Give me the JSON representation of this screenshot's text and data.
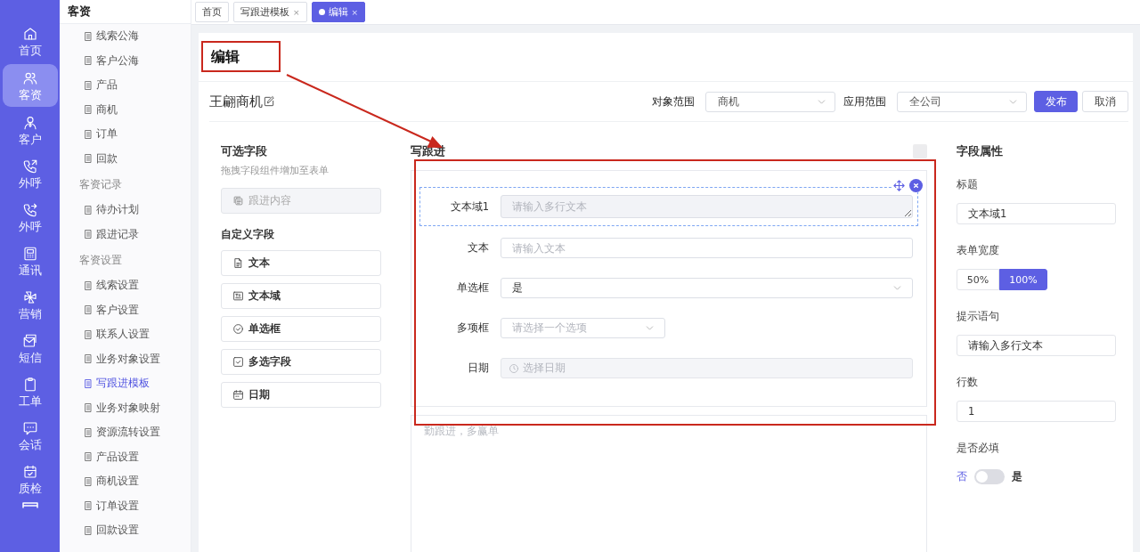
{
  "rail": [
    {
      "label": "首页",
      "selected": false
    },
    {
      "label": "客资",
      "selected": true
    },
    {
      "label": "客户",
      "selected": false
    },
    {
      "label": "外呼",
      "selected": false
    },
    {
      "label": "外呼",
      "selected": false
    },
    {
      "label": "通讯",
      "selected": false
    },
    {
      "label": "营销",
      "selected": false
    },
    {
      "label": "短信",
      "selected": false
    },
    {
      "label": "工单",
      "selected": false
    },
    {
      "label": "会话",
      "selected": false
    },
    {
      "label": "质检",
      "selected": false
    }
  ],
  "menu": {
    "title": "客资",
    "items": [
      {
        "kind": "link",
        "label": "线索公海",
        "selected": false
      },
      {
        "kind": "link",
        "label": "客户公海",
        "selected": false
      },
      {
        "kind": "link",
        "label": "产品",
        "selected": false
      },
      {
        "kind": "link",
        "label": "商机",
        "selected": false
      },
      {
        "kind": "link",
        "label": "订单",
        "selected": false
      },
      {
        "kind": "link",
        "label": "回款",
        "selected": false
      },
      {
        "kind": "group",
        "label": "客资记录"
      },
      {
        "kind": "link",
        "label": "待办计划",
        "selected": false
      },
      {
        "kind": "link",
        "label": "跟进记录",
        "selected": false
      },
      {
        "kind": "group",
        "label": "客资设置"
      },
      {
        "kind": "link",
        "label": "线索设置",
        "selected": false
      },
      {
        "kind": "link",
        "label": "客户设置",
        "selected": false
      },
      {
        "kind": "link",
        "label": "联系人设置",
        "selected": false
      },
      {
        "kind": "link",
        "label": "业务对象设置",
        "selected": false
      },
      {
        "kind": "link",
        "label": "写跟进模板",
        "selected": true
      },
      {
        "kind": "link",
        "label": "业务对象映射",
        "selected": false
      },
      {
        "kind": "link",
        "label": "资源流转设置",
        "selected": false
      },
      {
        "kind": "link",
        "label": "产品设置",
        "selected": false
      },
      {
        "kind": "link",
        "label": "商机设置",
        "selected": false
      },
      {
        "kind": "link",
        "label": "订单设置",
        "selected": false
      },
      {
        "kind": "link",
        "label": "回款设置",
        "selected": false
      }
    ]
  },
  "tabs": [
    {
      "label": "首页",
      "selected": false
    },
    {
      "label": "写跟进模板",
      "close": "×",
      "selected": false
    },
    {
      "label": "编辑",
      "close": "×",
      "selected": true
    }
  ],
  "page": {
    "title": "编辑",
    "name": "王翩商机",
    "filters": [
      {
        "label": "对象范围",
        "value": "商机"
      },
      {
        "label": "应用范围",
        "value": "全公司"
      }
    ],
    "buttons": [
      {
        "label": "发布",
        "kind": "primary"
      },
      {
        "label": "取消",
        "kind": "default"
      }
    ]
  },
  "palette": {
    "title": "可选字段",
    "hint": "拖拽字段组件增加至表单",
    "system": [
      {
        "label": "跟进内容",
        "disabled": true
      }
    ],
    "custom_title": "自定义字段",
    "custom": [
      {
        "label": "文本",
        "disabled": false
      },
      {
        "label": "文本域",
        "disabled": false
      },
      {
        "label": "单选框",
        "disabled": false
      },
      {
        "label": "多选字段",
        "disabled": false
      },
      {
        "label": "日期",
        "disabled": false
      }
    ]
  },
  "form": {
    "title": "写跟进",
    "fields": [
      {
        "kind": "textarea",
        "label": "文本域1",
        "placeholder": "请输入多行文本",
        "selected": true
      },
      {
        "kind": "text",
        "label": "文本",
        "placeholder": "请输入文本",
        "selected": false
      },
      {
        "kind": "select",
        "label": "单选框",
        "value": "是",
        "selected": false
      },
      {
        "kind": "multiselect",
        "label": "多项框",
        "placeholder": "请选择一个选项",
        "selected": false
      },
      {
        "kind": "date",
        "label": "日期",
        "placeholder": "选择日期",
        "selected": false
      }
    ],
    "note": {
      "placeholder": "勤跟进，多赢单"
    }
  },
  "properties": {
    "title": "字段属性",
    "rows": [
      {
        "kind": "input",
        "label": "标题",
        "value": "文本域1"
      },
      {
        "kind": "segmented",
        "label": "表单宽度",
        "options": [
          {
            "label": "50%",
            "selected": false
          },
          {
            "label": "100%",
            "selected": true
          }
        ]
      },
      {
        "kind": "input",
        "label": "提示语句",
        "value": "请输入多行文本"
      },
      {
        "kind": "input",
        "label": "行数",
        "value": "1"
      },
      {
        "kind": "switch",
        "label": "是否必填",
        "off_label": "否",
        "on_label": "是",
        "on": false
      }
    ]
  },
  "annotations": [
    {
      "kind": "box"
    },
    {
      "kind": "box"
    },
    {
      "kind": "arrow"
    }
  ]
}
